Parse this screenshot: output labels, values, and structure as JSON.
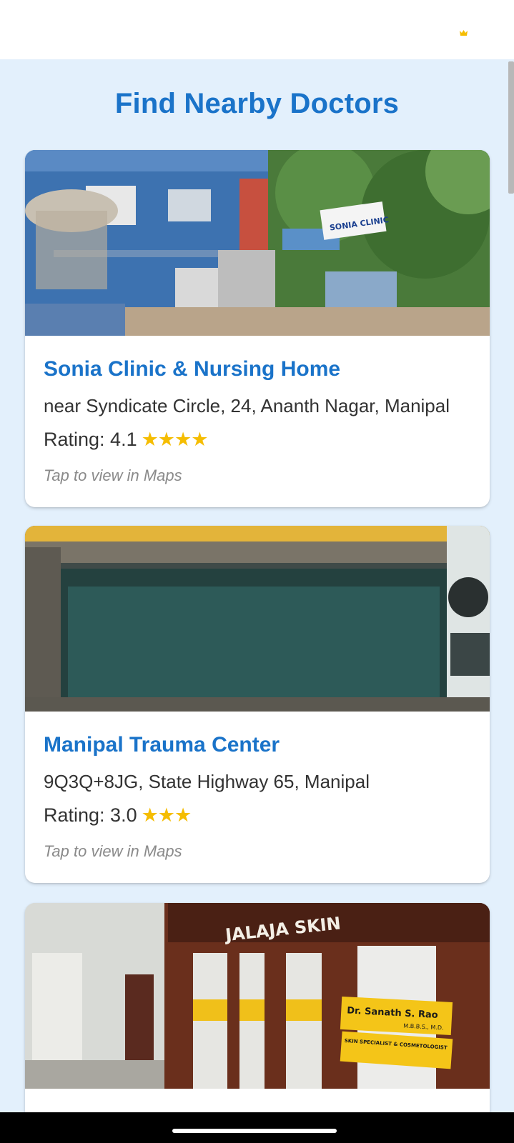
{
  "app": {
    "title": "Find Nearby Doctors",
    "accent_color": "#1a73c9",
    "star_color": "#f5bd02",
    "background_color": "#e3f0fc"
  },
  "topbar": {
    "icon": "crown-icon"
  },
  "doctors": [
    {
      "name": "Sonia Clinic & Nursing Home",
      "address": "near Syndicate Circle, 24, Ananth Nagar, Manipal",
      "rating_label": "Rating: 4.1",
      "rating": 4.1,
      "stars": "★★★★",
      "hint": "Tap to view in Maps",
      "photo_sign": "SONIA CLINIC"
    },
    {
      "name": "Manipal Trauma Center",
      "address": "9Q3Q+8JG, State Highway 65, Manipal",
      "rating_label": "Rating: 3.0",
      "rating": 3.0,
      "stars": "★★★",
      "hint": "Tap to view in Maps"
    },
    {
      "photo_sign": "JALAJA SKIN",
      "photo_board_name": "Dr. Sanath S. Rao",
      "photo_board_degree": "M.B.B.S., M.D.",
      "photo_board_specialty": "SKIN SPECIALIST & COSMETOLOGIST"
    }
  ]
}
